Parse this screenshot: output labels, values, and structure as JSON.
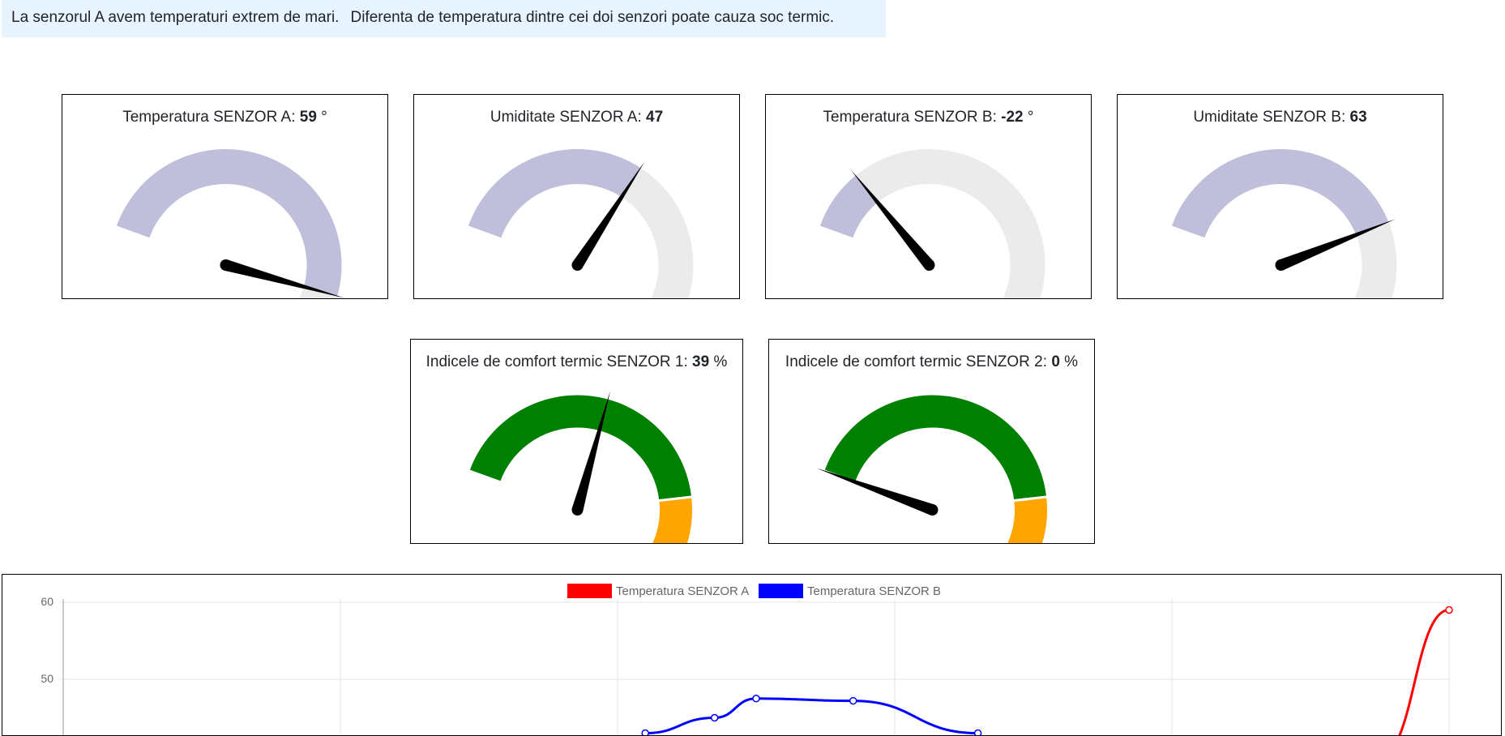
{
  "alert": {
    "message_a": "La senzorul A avem temperaturi extrem de mari.",
    "message_b": "Diferenta de temperatura dintre cei doi senzori poate cauza soc termic."
  },
  "gauges": [
    {
      "label": "Temperatura SENZOR A: ",
      "value": "59",
      "unit": " °",
      "fraction": 0.8
    },
    {
      "label": "Umiditate SENZOR A: ",
      "value": "47",
      "unit": "",
      "fraction": 0.47
    },
    {
      "label": "Temperatura SENZOR B: ",
      "value": "-22",
      "unit": " °",
      "fraction": 0.14
    },
    {
      "label": "Umiditate SENZOR B: ",
      "value": "63",
      "unit": "",
      "fraction": 0.63
    }
  ],
  "comfort": [
    {
      "label": "Indicele de comfort termic SENZOR 1: ",
      "value": "39",
      "unit": " %",
      "fraction": 0.39
    },
    {
      "label": "Indicele de comfort termic SENZOR 2: ",
      "value": "0",
      "unit": " %",
      "fraction": 0.0
    }
  ],
  "comfort_bands": [
    {
      "from": 0.0,
      "to": 0.7,
      "color": "#008000"
    },
    {
      "from": 0.7,
      "to": 0.85,
      "color": "#ffa500"
    },
    {
      "from": 0.85,
      "to": 1.0,
      "color": "#ff0000"
    }
  ],
  "colors": {
    "gauge_fill": "#bfbedb",
    "gauge_track": "#ebebeb",
    "needle": "#000000",
    "alert_bg": "#e7f3fe",
    "series_a": "#ff0000",
    "series_b": "#0000ff"
  },
  "chart_data": {
    "type": "line",
    "legend_position": "top",
    "grid": true,
    "ylim": [
      40,
      60
    ],
    "yticks": [
      "60",
      "50"
    ],
    "series": [
      {
        "name": "Temperatura SENZOR A",
        "color": "#ff0000",
        "points": [
          [
            4.75,
            40
          ],
          [
            5.0,
            59
          ]
        ]
      },
      {
        "name": "Temperatura SENZOR B",
        "color": "#0000ff",
        "points": [
          [
            2.1,
            43
          ],
          [
            2.35,
            45
          ],
          [
            2.5,
            47.5
          ],
          [
            2.85,
            47.2
          ],
          [
            3.3,
            43
          ]
        ]
      }
    ],
    "x_gridlines": 6
  }
}
